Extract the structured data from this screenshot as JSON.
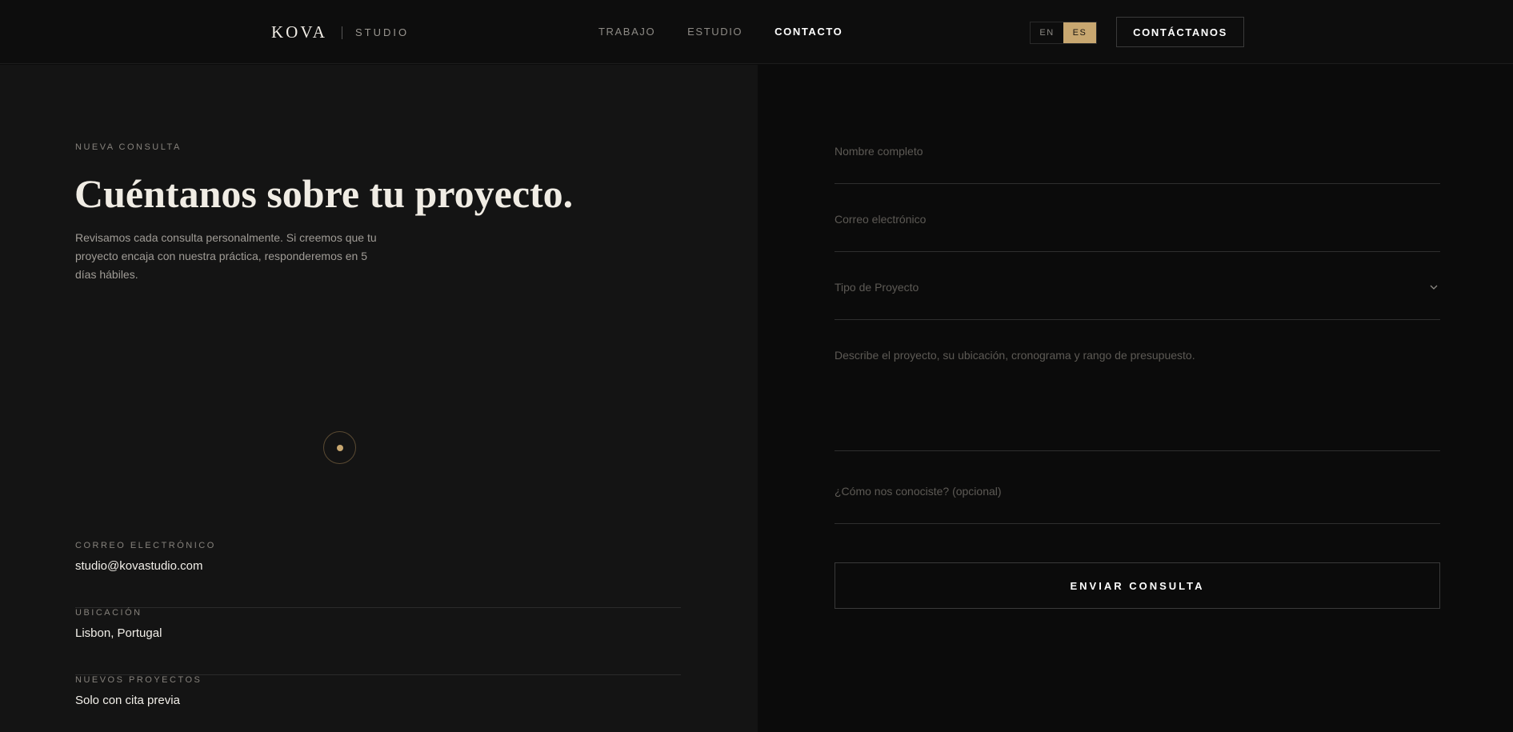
{
  "header": {
    "logo_main": "KOVA",
    "logo_sub": "STUDIO",
    "nav": [
      {
        "label": "TRABAJO",
        "active": false
      },
      {
        "label": "ESTUDIO",
        "active": false
      },
      {
        "label": "CONTACTO",
        "active": true
      }
    ],
    "lang": {
      "en": "EN",
      "es": "ES",
      "selected": "ES"
    },
    "cta_label": "CONTÁCTANOS"
  },
  "intro": {
    "eyebrow": "NUEVA CONSULTA",
    "title": "Cuéntanos sobre tu proyecto.",
    "body": "Revisamos cada consulta personalmente. Si creemos que tu proyecto encaja con nuestra práctica, responderemos en 5 días hábiles."
  },
  "info": [
    {
      "label": "CORREO ELECTRÓNICO",
      "value": "studio@kovastudio.com"
    },
    {
      "label": "UBICACIÓN",
      "value": "Lisbon, Portugal"
    },
    {
      "label": "NUEVOS PROYECTOS",
      "value": "Solo con cita previa"
    }
  ],
  "form": {
    "name_placeholder": "Nombre completo",
    "email_placeholder": "Correo electrónico",
    "type_placeholder": "Tipo de Proyecto",
    "message_placeholder": "Describe el proyecto, su ubicación, cronograma y rango de presupuesto.",
    "source_placeholder": "¿Cómo nos conociste? (opcional)",
    "submit_label": "ENVIAR CONSULTA"
  },
  "colors": {
    "accent": "#c8a770",
    "bg_left": "#141414",
    "bg_right": "#0b0b0b"
  },
  "icons": {
    "select": "chevron-down-icon",
    "indicator": "dot-indicator-icon"
  }
}
